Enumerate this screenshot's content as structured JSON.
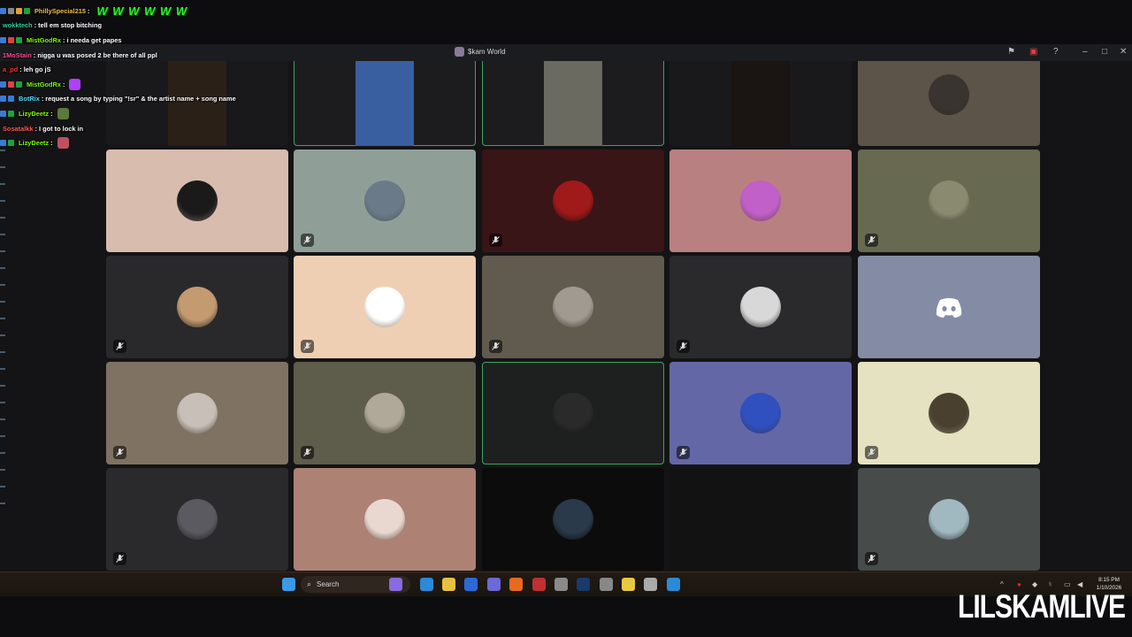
{
  "window": {
    "title": "$kam World"
  },
  "chat": [
    {
      "user": "PhillySpecial215",
      "user_color": "#f0c040",
      "message": "",
      "emote_text": "W W W W W W",
      "badges": [
        "#3a7bd5",
        "#888888",
        "#e0a030",
        "#20a040"
      ]
    },
    {
      "user": "wokktech",
      "user_color": "#2ed0a0",
      "message": "tell em stop bitching",
      "badges": []
    },
    {
      "user": "MistGodRx",
      "user_color": "#7cfc00",
      "message": "i needa get papes",
      "badges": [
        "#3a7bd5",
        "#e04040",
        "#20a040"
      ]
    },
    {
      "user": "1MoStain",
      "user_color": "#ff4a9a",
      "message": "nigga u was posed 2 be there of all ppl",
      "badges": []
    },
    {
      "user": "a_pd",
      "user_color": "#ff3030",
      "message": "leh go jS",
      "badges": []
    },
    {
      "user": "MistGodRx",
      "user_color": "#7cfc00",
      "message": "",
      "badges": [
        "#3a7bd5",
        "#e04040",
        "#20a040"
      ],
      "pic": "#b040ff"
    },
    {
      "user": "BotRix",
      "user_color": "#50e0ff",
      "message": "request a song by typing \"!sr\" & the artist name + song name",
      "badges": [
        "#3a7bd5",
        "#3a7bd5"
      ]
    },
    {
      "user": "LizyDeetz",
      "user_color": "#7cfc00",
      "message": "",
      "badges": [
        "#3a7bd5",
        "#20a040"
      ],
      "pic": "#5a7a3a"
    },
    {
      "user": "Sosatalkk",
      "user_color": "#ff5a5a",
      "message": "I got to lock in",
      "badges": []
    },
    {
      "user": "LizyDeetz",
      "user_color": "#7cfc00",
      "message": "",
      "badges": [
        "#3a7bd5",
        "#20a040"
      ],
      "pic": "#c05060"
    }
  ],
  "tiles": [
    {
      "bg": "#19191b",
      "video": "#2a2018",
      "speaking": false,
      "muted": false,
      "avatar": null
    },
    {
      "bg": "#1c1c1e",
      "video": "#3a5fa0",
      "speaking": true,
      "muted": false,
      "avatar": null
    },
    {
      "bg": "#1c1c1e",
      "video": "#6a6a60",
      "speaking": true,
      "muted": false,
      "avatar": null
    },
    {
      "bg": "#19191b",
      "video": "#1a1412",
      "speaking": false,
      "muted": false,
      "avatar": null
    },
    {
      "bg": "#5c5448",
      "video": null,
      "speaking": false,
      "muted": false,
      "avatar": "#3a3430"
    },
    {
      "bg": "#d8bcae",
      "speaking": false,
      "muted": false,
      "avatar": "#1a1a1a"
    },
    {
      "bg": "#8f9f98",
      "speaking": false,
      "muted": true,
      "avatar": "#6a7a88"
    },
    {
      "bg": "#3a1518",
      "speaking": false,
      "muted": true,
      "avatar": "#a01a1a"
    },
    {
      "bg": "#b98082",
      "speaking": false,
      "muted": false,
      "avatar": "#c060c8"
    },
    {
      "bg": "#676a50",
      "speaking": false,
      "muted": true,
      "avatar": "#8a8a70"
    },
    {
      "bg": "#29292b",
      "speaking": false,
      "muted": true,
      "avatar": "#c49a70"
    },
    {
      "bg": "#efcfb3",
      "speaking": false,
      "muted": true,
      "avatar": "#ffffff"
    },
    {
      "bg": "#615a4f",
      "speaking": false,
      "muted": true,
      "avatar": "#a09a90"
    },
    {
      "bg": "#2a2a2c",
      "speaking": false,
      "muted": true,
      "avatar": "#d8d8d8"
    },
    {
      "bg": "#848ca5",
      "speaking": false,
      "muted": false,
      "avatar": "discord"
    },
    {
      "bg": "#7f7262",
      "speaking": false,
      "muted": true,
      "avatar": "#c8c0b8"
    },
    {
      "bg": "#5e5c4b",
      "speaking": false,
      "muted": true,
      "avatar": "#b0a898"
    },
    {
      "bg": "#1e1f1f",
      "speaking": true,
      "muted": false,
      "avatar": "#2a2a2a"
    },
    {
      "bg": "#6467a6",
      "speaking": false,
      "muted": true,
      "avatar": "#3050c0"
    },
    {
      "bg": "#e4e2c0",
      "speaking": false,
      "muted": true,
      "avatar": "#4a4030"
    },
    {
      "bg": "#2a2a2c",
      "speaking": false,
      "muted": true,
      "avatar": "#5a5a60"
    },
    {
      "bg": "#ad8174",
      "speaking": false,
      "muted": false,
      "avatar": "#e8d8d0"
    },
    {
      "bg": "#0c0c0d",
      "speaking": false,
      "muted": false,
      "avatar": "#2a3a4a"
    },
    {
      "bg": "#121213",
      "speaking": false,
      "muted": false,
      "avatar": null
    },
    {
      "bg": "#474b4a",
      "speaking": false,
      "muted": true,
      "avatar": "#a0b8c0"
    }
  ],
  "taskbar": {
    "search_label": "Search",
    "time": "8:15 PM",
    "date": "1/10/2026",
    "apps": [
      "#8a6adf",
      "#2a8ad8",
      "#e8c040",
      "#2a6ad8",
      "#6a6ad8",
      "#e86a20",
      "#c03030",
      "#8a8a8a",
      "#1a3a6a",
      "#888888",
      "#e8c840",
      "#aaaaaa",
      "#2a8ad8"
    ],
    "app_icons": [
      "widgets-icon",
      "copilot-icon",
      "file-explorer-icon",
      "store-icon",
      "discord-icon",
      "brave-icon",
      "shield-icon",
      "chrome-icon",
      "steam-icon",
      "app-icon",
      "app-icon",
      "4k-icon",
      "notepad-icon"
    ]
  },
  "watermark": "LILSKAMLIVE"
}
